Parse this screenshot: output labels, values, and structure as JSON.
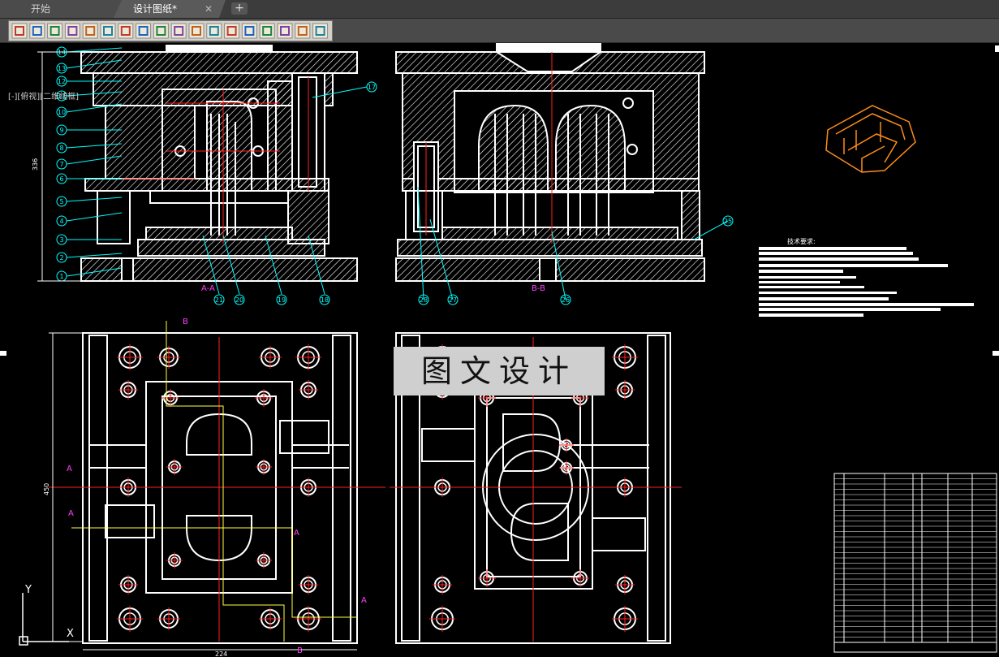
{
  "tabs": [
    {
      "label": "开始"
    },
    {
      "label": "设计图纸*"
    }
  ],
  "new_tab_label": "+",
  "tab_close_glyph": "✕",
  "toolbar": {
    "icons": [
      "library-icon",
      "shaft-icon",
      "bearing-icon",
      "spring-icon",
      "gear-icon",
      "screw-icon",
      "pin-icon",
      "key-icon",
      "nut-icon",
      "washer-icon",
      "rivet-icon",
      "profile-icon",
      "frame-icon",
      "beam-icon",
      "weld-icon",
      "hole-icon",
      "bolt-icon",
      "clamp-icon"
    ]
  },
  "viewport_label": "[-][俯视][二维线框]",
  "watermark": "图文设计",
  "drawing": {
    "section_aa": "A-A",
    "section_bb": "B-B",
    "tech_req_title": "技术要求:",
    "callouts_left": [
      "1",
      "2",
      "3",
      "4",
      "5",
      "6",
      "7",
      "8",
      "9",
      "10",
      "11",
      "12",
      "13",
      "14"
    ],
    "callouts_bottom_left": [
      "21",
      "20",
      "19",
      "18"
    ],
    "callouts_right": [
      "17"
    ],
    "callouts_bb": [
      "28",
      "27",
      "26",
      "25"
    ],
    "dimensions": {
      "height_left": "336",
      "width_top": "224",
      "height_plan": "450",
      "width_bottom": "224"
    },
    "view_markers": [
      "A",
      "B"
    ]
  },
  "colors": {
    "background": "#000000",
    "lines": "#ffffff",
    "hatch": "#ffffff",
    "centerline": "#ff2020",
    "leader": "#00ffff",
    "iso_view": "#ff8c1a",
    "section_marker": "#ff40ff",
    "yellow": "#ffff40"
  }
}
